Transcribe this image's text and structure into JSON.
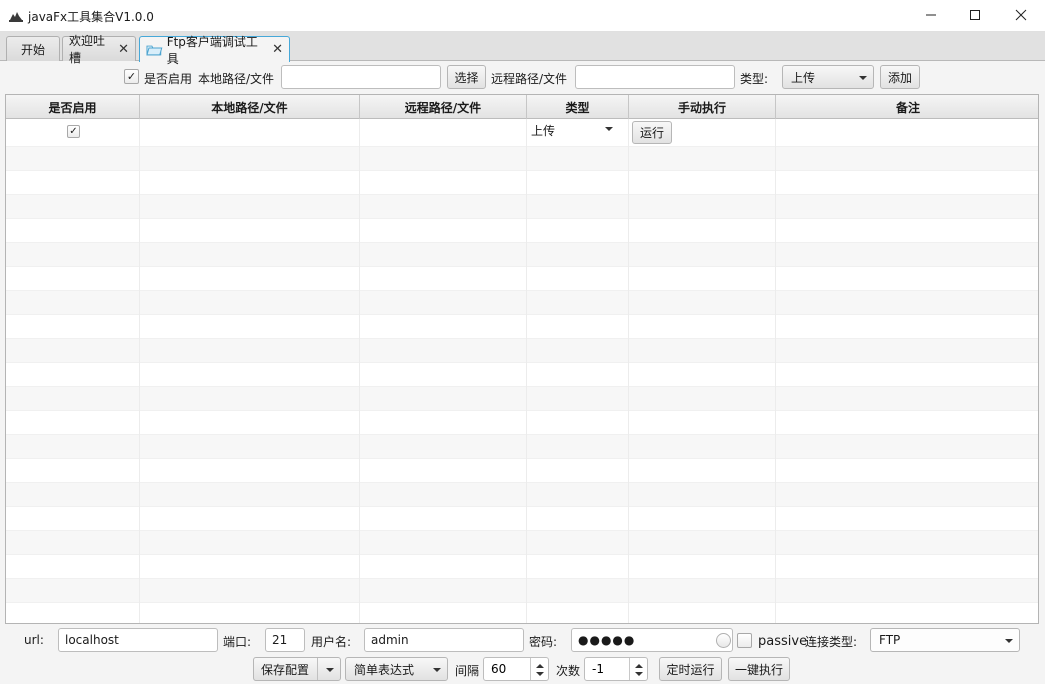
{
  "window": {
    "title": "javaFx工具集合V1.0.0",
    "icon": "app-logo-icon"
  },
  "tabs": [
    {
      "label": "开始",
      "closable": false
    },
    {
      "label": "欢迎吐槽",
      "closable": true
    },
    {
      "label": "Ftp客户端调试工具",
      "closable": true,
      "active": true,
      "icon": "folder-icon"
    }
  ],
  "toolbar": {
    "enabled_checked": true,
    "enabled_label": "是否启用",
    "local_path_label": "本地路径/文件",
    "local_path_value": "",
    "choose_label": "选择",
    "remote_path_label": "远程路径/文件",
    "remote_path_value": "",
    "type_label": "类型:",
    "type_value": "上传",
    "add_label": "添加"
  },
  "table": {
    "columns": [
      "是否启用",
      "本地路径/文件",
      "远程路径/文件",
      "类型",
      "手动执行",
      "备注"
    ],
    "rows": [
      {
        "enabled": true,
        "local": "",
        "remote": "",
        "type": "上传",
        "action": "运行",
        "note": ""
      }
    ]
  },
  "bottom": {
    "url_label": "url:",
    "url_value": "localhost",
    "port_label": "端口:",
    "port_value": "21",
    "user_label": "用户名:",
    "user_value": "admin",
    "password_label": "密码:",
    "password_value": "●●●●●",
    "passive_checked": false,
    "passive_label": "passive",
    "conn_type_label": "连接类型:",
    "conn_type_value": "FTP",
    "save_config_label": "保存配置",
    "expression_value": "简单表达式",
    "interval_label": "间隔",
    "interval_value": "60",
    "count_label": "次数",
    "count_value": "-1",
    "timed_run_label": "定时运行",
    "run_all_label": "一键执行"
  }
}
